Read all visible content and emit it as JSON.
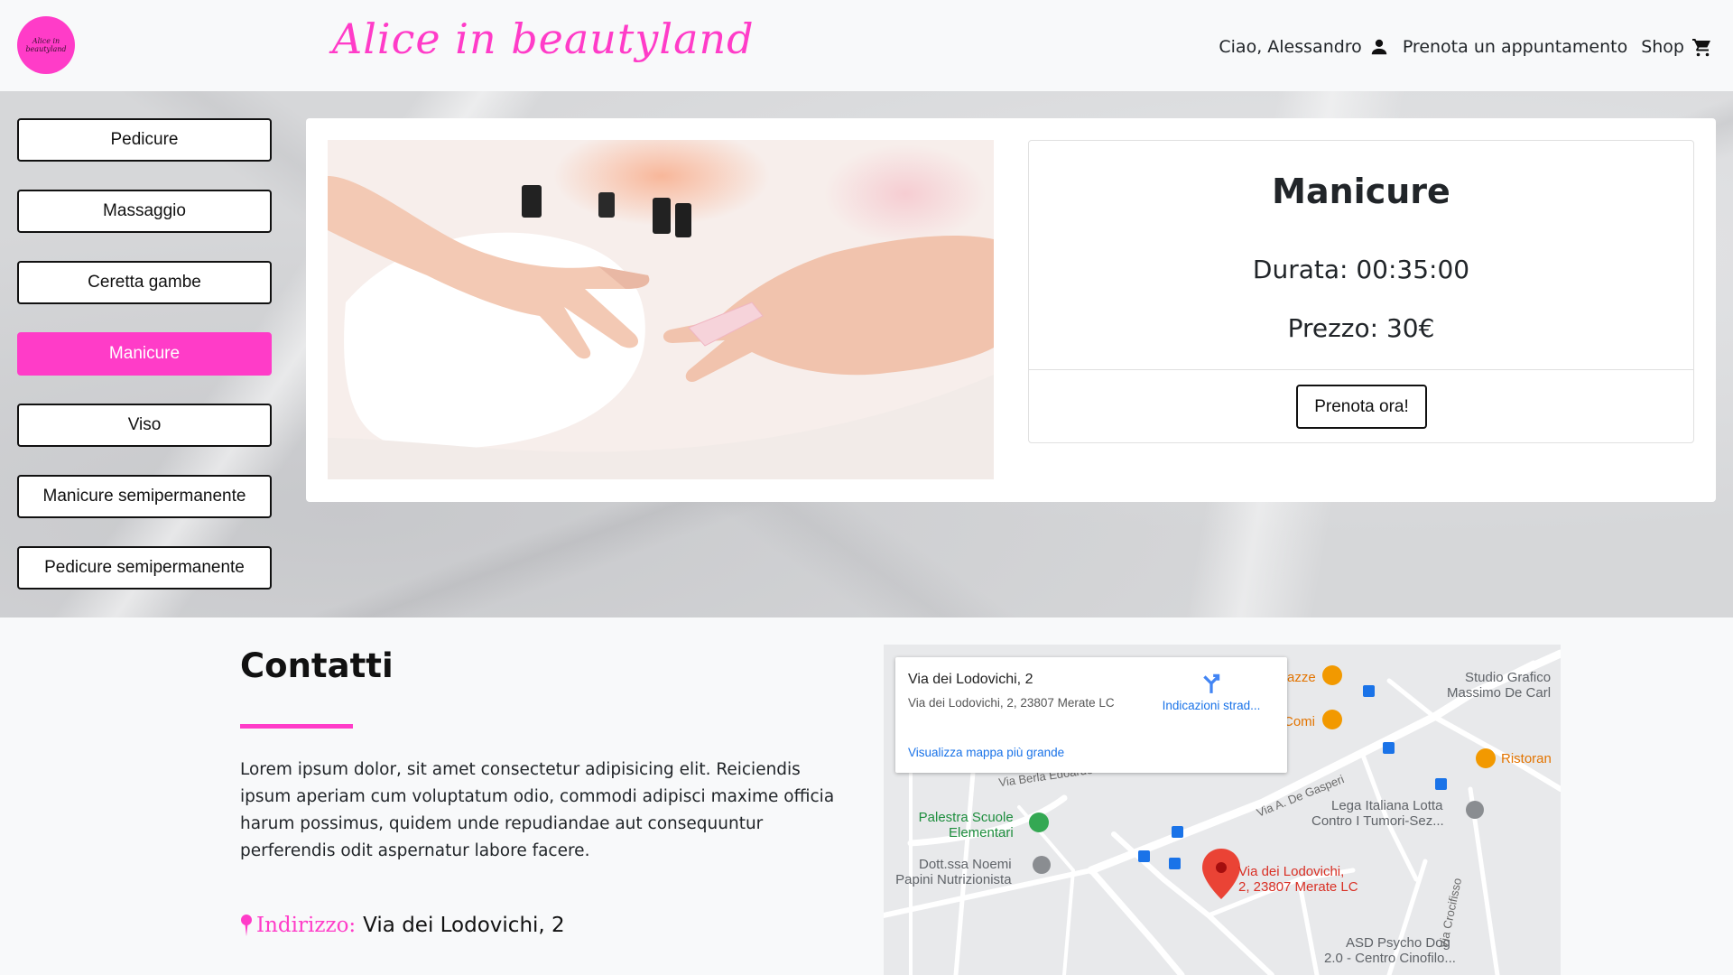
{
  "header": {
    "logo_text": "Alice in beautyland",
    "brand": "Alice in beautyland",
    "greeting": "Ciao, Alessandro",
    "book_link": "Prenota un appuntamento",
    "shop_link": "Shop"
  },
  "services": [
    {
      "label": "Pedicure",
      "active": false
    },
    {
      "label": "Massaggio",
      "active": false
    },
    {
      "label": "Ceretta gambe",
      "active": false
    },
    {
      "label": "Manicure",
      "active": true
    },
    {
      "label": "Viso",
      "active": false
    },
    {
      "label": "Manicure semipermanente",
      "active": false
    },
    {
      "label": "Pedicure semipermanente",
      "active": false
    }
  ],
  "service_card": {
    "title": "Manicure",
    "duration": "Durata: 00:35:00",
    "price": "Prezzo: 30€",
    "book_button": "Prenota ora!"
  },
  "contacts": {
    "title": "Contatti",
    "body": "Lorem ipsum dolor, sit amet consectetur adipisicing elit. Reiciendis ipsum aperiam cum voluptatum odio, commodi adipisci maxime officia harum possimus, quidem unde repudiandae aut consequuntur perferendis odit aspernatur labore facere.",
    "address_label": "Indirizzo:",
    "address_value": "Via dei Lodovichi, 2"
  },
  "map": {
    "popup_title": "Via dei Lodovichi, 2",
    "popup_address": "Via dei Lodovichi, 2, 23807 Merate LC",
    "directions": "Indicazioni strad...",
    "larger_map": "Visualizza mappa più grande",
    "pin_label_1": "Via dei Lodovichi,",
    "pin_label_2": "2, 23807 Merate LC",
    "poi_palestra_1": "Palestra Scuole",
    "poi_palestra_2": "Elementari",
    "poi_noemi_1": "Dott.ssa Noemi",
    "poi_noemi_2": "Papini Nutrizionista",
    "poi_studio_1": "Studio Grafico",
    "poi_studio_2": "Massimo De Carl",
    "poi_lega_1": "Lega Italiana Lotta",
    "poi_lega_2": "Contro I Tumori-Sez...",
    "poi_asd_1": "ASD Psycho Dog",
    "poi_asd_2": "2.0 - Centro Cinofilo...",
    "poi_ristoran": "Ristoran",
    "poi_azze": "azze",
    "poi_comi": "Comi",
    "road_berla": "Via Berla Edoardo",
    "road_gasperi": "Via A. De Gasperi",
    "road_crocifisso": "Via Crocifisso",
    "colors": {
      "water": "#e8e9eb",
      "pin": "#ea4335",
      "green_pin": "#34a853",
      "orange_pin": "#f29900"
    }
  },
  "colors": {
    "accent": "#ff3cc8",
    "nav_bg": "#f8f9fa"
  }
}
